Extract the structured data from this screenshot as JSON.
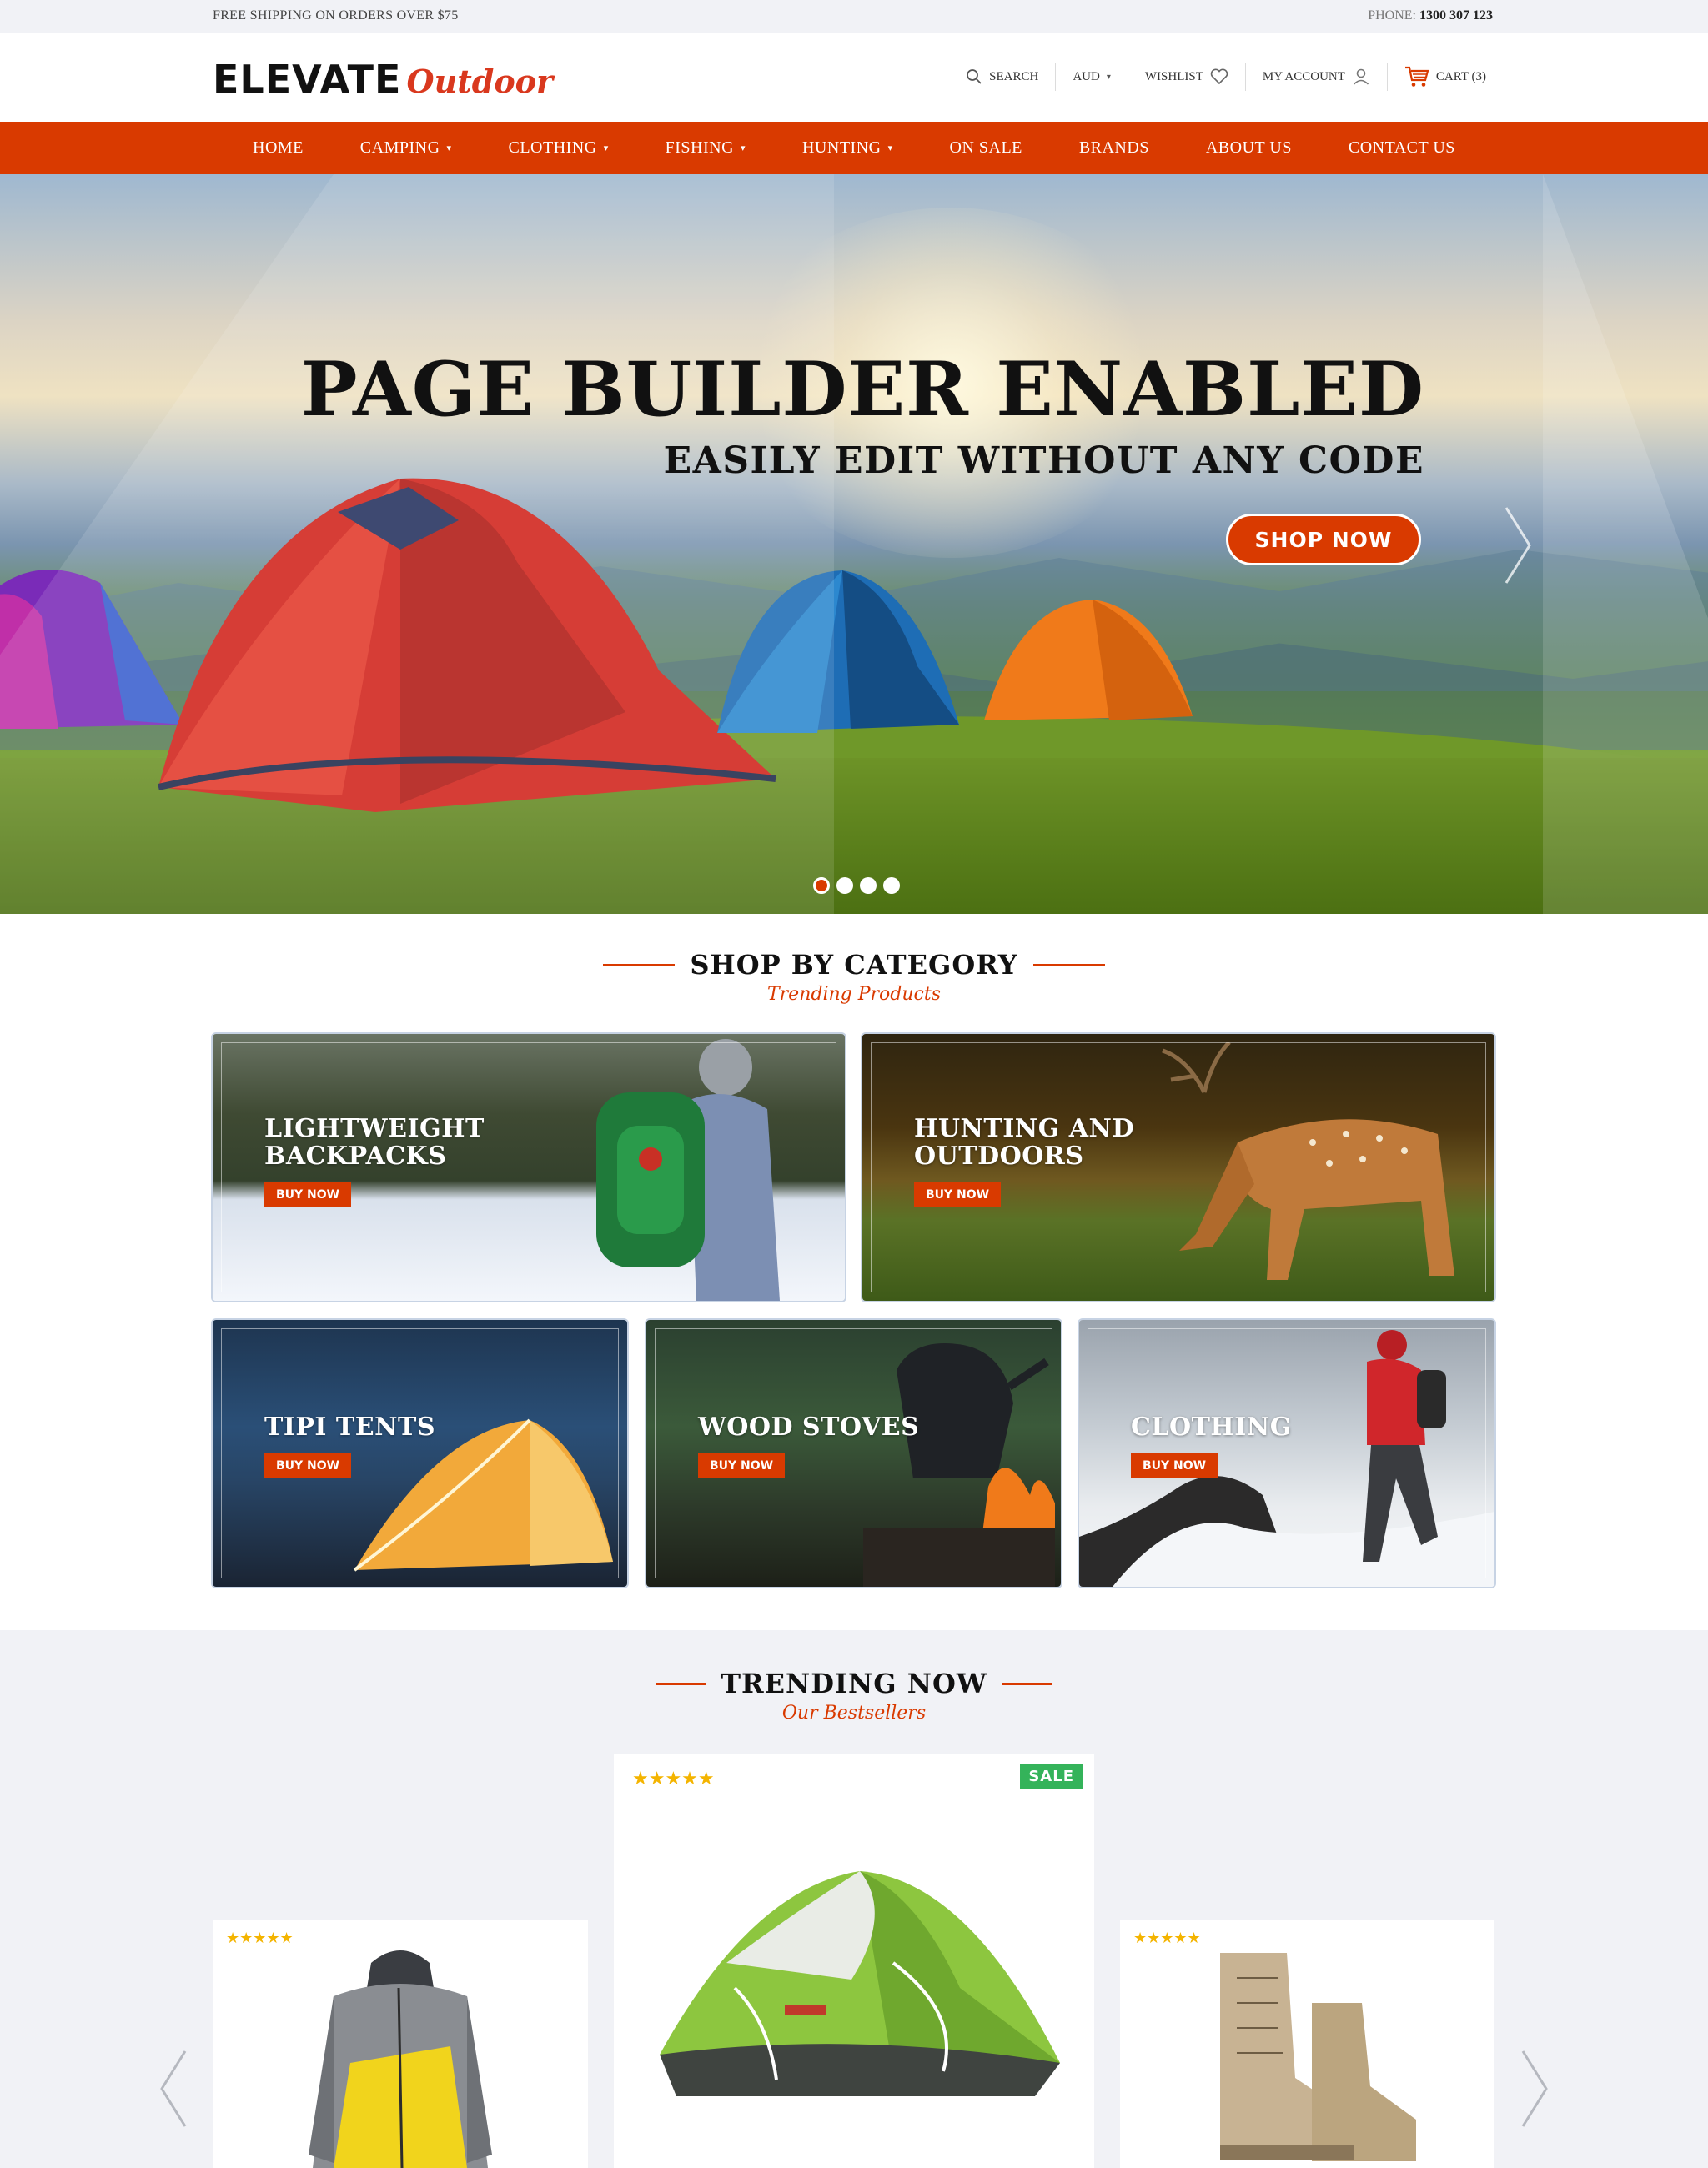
{
  "topbar": {
    "shipping_text": "FREE SHIPPING ON ORDERS OVER $75",
    "phone_label": "PHONE:",
    "phone_number": "1300 307 123"
  },
  "header": {
    "logo_main": "ELEVATE",
    "logo_script": "Outdoor",
    "search_label": "SEARCH",
    "currency_label": "AUD",
    "wishlist_label": "WISHLIST",
    "account_label": "MY ACCOUNT",
    "cart_label": "CART (3)"
  },
  "nav": {
    "items": [
      {
        "label": "HOME"
      },
      {
        "label": "CAMPING"
      },
      {
        "label": "CLOTHING"
      },
      {
        "label": "FISHING"
      },
      {
        "label": "HUNTING"
      },
      {
        "label": "ON SALE"
      },
      {
        "label": "BRANDS"
      },
      {
        "label": "ABOUT US"
      },
      {
        "label": "CONTACT US"
      }
    ]
  },
  "hero": {
    "title": "PAGE BUILDER ENABLED",
    "subtitle": "EASILY EDIT WITHOUT ANY CODE",
    "button_label": "SHOP NOW",
    "slide_count": 4,
    "active_slide": 1
  },
  "category_section": {
    "title": "SHOP BY CATEGORY",
    "subtitle": "Trending Products",
    "tiles": [
      {
        "label": "LIGHTWEIGHT\nBACKPACKS",
        "button": "BUY NOW"
      },
      {
        "label": "HUNTING  AND\nOUTDOORS",
        "button": "BUY NOW"
      },
      {
        "label": "TIPI TENTS",
        "button": "BUY NOW"
      },
      {
        "label": "WOOD STOVES",
        "button": "BUY NOW"
      },
      {
        "label": "CLOTHING",
        "button": "BUY NOW"
      }
    ]
  },
  "trending_section": {
    "title": "TRENDING NOW",
    "subtitle": "Our Bestsellers",
    "products": [
      {
        "image": "puffer-jacket",
        "rating": 5
      },
      {
        "image": "dome-tent",
        "rating": 5,
        "badge": "SALE"
      },
      {
        "image": "hiking-boots",
        "rating": 5
      }
    ]
  },
  "colors": {
    "accent": "#d93a00",
    "sale_badge": "#34b35a",
    "star": "#f4b400",
    "topbar_bg": "#f1f2f6"
  }
}
